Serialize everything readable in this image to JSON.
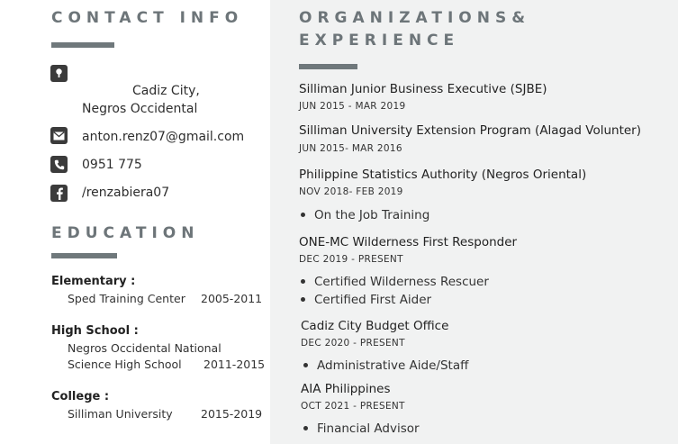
{
  "contact": {
    "heading": "CONTACT INFO",
    "address_line1": "Cadiz City,",
    "address_line2": "Negros Occidental",
    "email": "anton.renz07@gmail.com",
    "phone": "0951 775",
    "facebook": "/renzabiera07"
  },
  "education": {
    "heading": "EDUCATION",
    "entries": [
      {
        "label": "Elementary :",
        "school_line1": "Sped Training Center",
        "school_line2": "",
        "years": "2005-2011"
      },
      {
        "label": "High School :",
        "school_line1": "Negros Occidental National",
        "school_line2": "Science High School",
        "years": "2011-2015"
      },
      {
        "label": "College :",
        "school_line1": "Silliman University",
        "school_line2": "",
        "years": "2015-2019"
      }
    ]
  },
  "experience": {
    "heading_line1": "ORGANIZATIONS&",
    "heading_line2": "EXPERIENCE",
    "entries": [
      {
        "title": "Silliman Junior Business Executive (SJBE)",
        "date": "JUN 2015 - MAR 2019",
        "bullets": []
      },
      {
        "title": "Silliman University Extension Program (Alagad Volunter)",
        "date": "JUN 2015- MAR 2016",
        "bullets": []
      },
      {
        "title": "Philippine Statistics Authority (Negros Oriental)",
        "date": "NOV 2018- FEB 2019",
        "bullets": [
          "On the Job Training"
        ]
      },
      {
        "title": "ONE-MC Wilderness First Responder",
        "date": "DEC 2019 - PRESENT",
        "bullets": [
          "Certified Wilderness Rescuer",
          "Certified First Aider"
        ]
      },
      {
        "title": "Cadiz City Budget Office",
        "date": "DEC 2020 - PRESENT",
        "bullets": [
          "Administrative Aide/Staff"
        ]
      },
      {
        "title": "AIA Philippines",
        "date": "OCT 2021 - PRESENT",
        "bullets": [
          "Financial Advisor"
        ]
      }
    ]
  },
  "icons": {
    "address": "location-pin-icon",
    "email": "envelope-icon",
    "phone": "phone-icon",
    "facebook": "facebook-icon"
  },
  "colors": {
    "heading": "#6d7579",
    "bar": "#6f787b",
    "right_panel": "#f1f2f2",
    "icon_bg": "#3b3b3b"
  }
}
